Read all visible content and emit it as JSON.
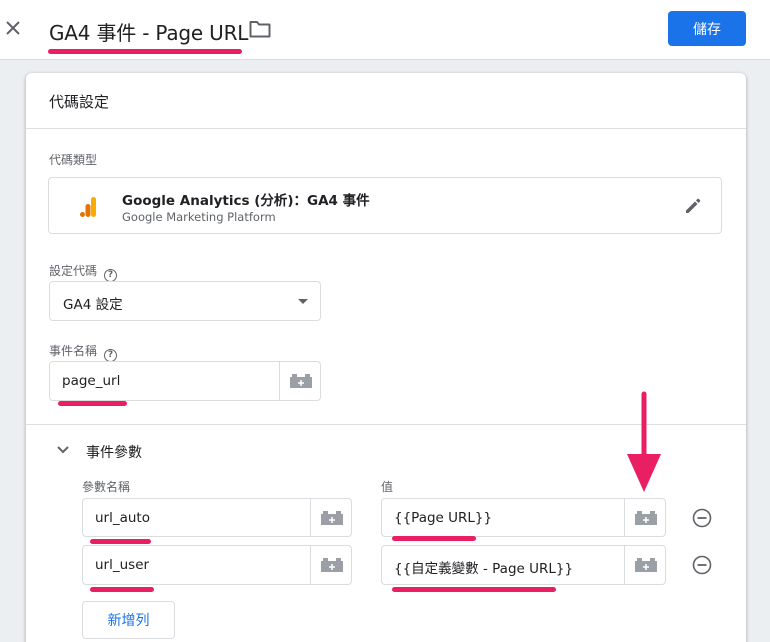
{
  "header": {
    "title": "GA4 事件 - Page URL",
    "save_label": "儲存"
  },
  "card": {
    "title": "代碼設定",
    "tag_type_label": "代碼類型",
    "tag_type": {
      "name": "Google Analytics (分析)：GA4 事件",
      "subtitle": "Google Marketing Platform"
    },
    "config_tag_label": "設定代碼",
    "config_tag_value": "GA4 設定",
    "event_name_label": "事件名稱",
    "event_name_value": "page_url",
    "params_section_title": "事件參數",
    "param_name_header": "參數名稱",
    "param_value_header": "值",
    "params": [
      {
        "name": "url_auto",
        "value": "{{Page URL}}"
      },
      {
        "name": "url_user",
        "value": "{{自定義變數 - Page URL}}"
      }
    ],
    "add_row_label": "新增列"
  },
  "colors": {
    "accent": "#1a73e8",
    "highlight": "#e91e63",
    "ga_orange": "#f9ab00",
    "ga_dark_orange": "#e37400"
  },
  "icons": [
    "close-icon",
    "folder-icon",
    "google-analytics-icon",
    "pencil-icon",
    "help-icon",
    "variable-picker-icon",
    "chevron-down-icon",
    "remove-circle-icon",
    "arrow-down-annotation"
  ]
}
